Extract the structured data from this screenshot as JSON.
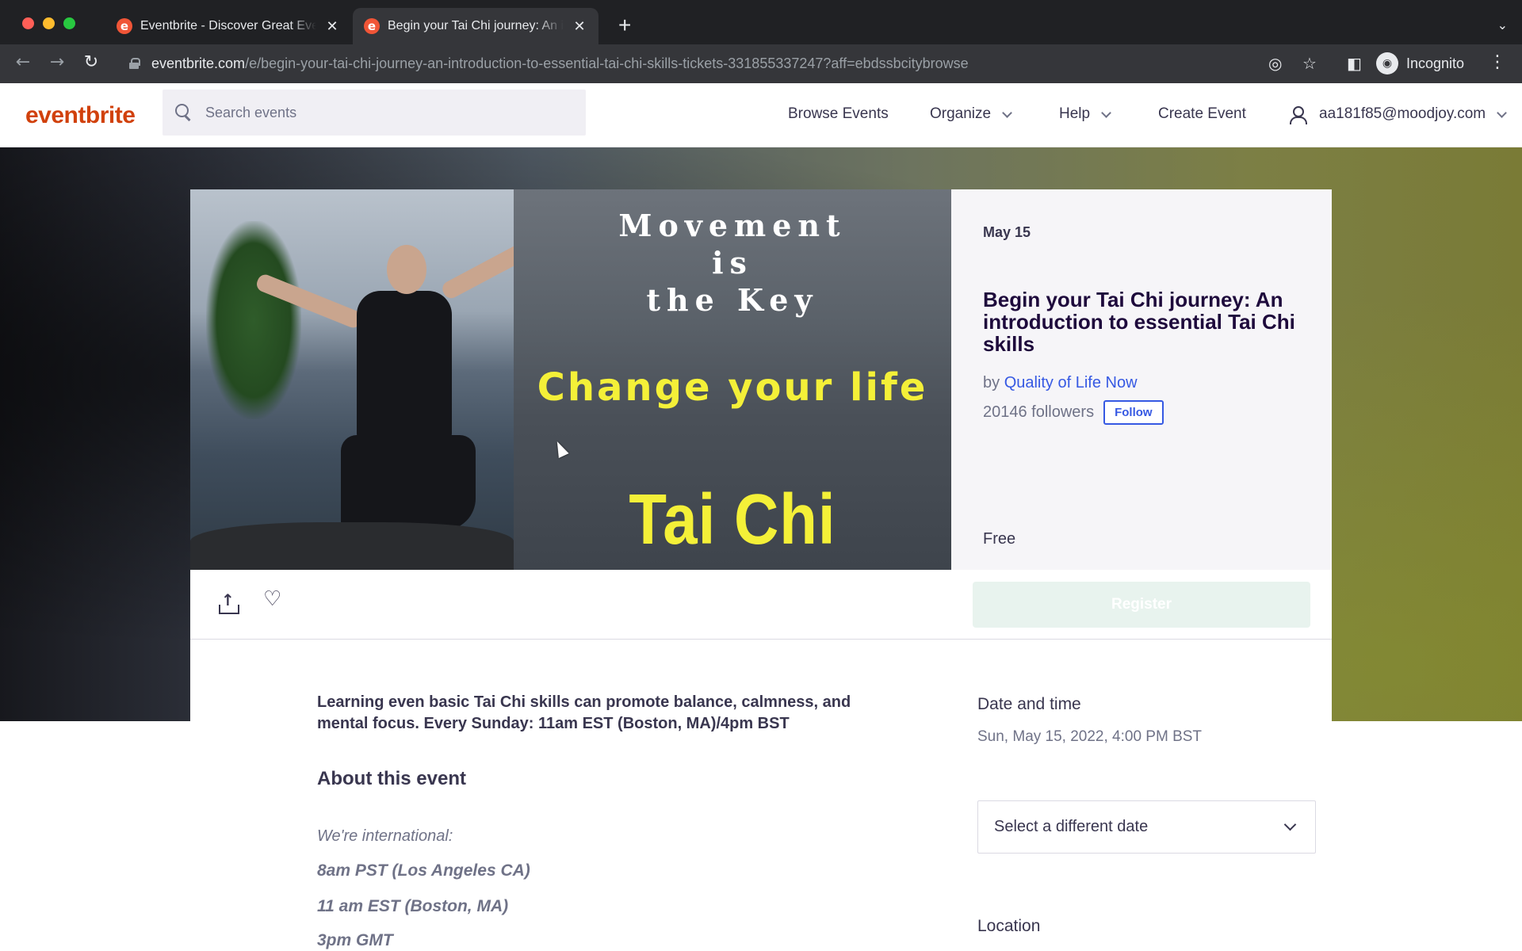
{
  "browser": {
    "tabs": [
      {
        "title": "Eventbrite - Discover Great Events or Create Your Own",
        "favicon": "e",
        "active": false
      },
      {
        "title": "Begin your Tai Chi journey: An introduction to essential Tai Chi skills Tickets",
        "favicon": "e",
        "active": true
      }
    ],
    "new_tab_symbol": "+",
    "overflow_symbol": "⌄",
    "url_domain": "eventbrite.com",
    "url_path": "/e/begin-your-tai-chi-journey-an-introduction-to-essential-tai-chi-skills-tickets-331855337247?aff=ebdssbcitybrowse",
    "profile_label": "Incognito",
    "icons": {
      "back": "arrow-left-icon",
      "forward": "arrow-right-icon",
      "reload": "reload-icon",
      "lock": "lock-icon",
      "eye_off": "eye-off-icon",
      "star": "star-icon",
      "side_panel": "side-panel-icon",
      "menu": "kebab-menu-icon"
    }
  },
  "header": {
    "logo": "eventbrite",
    "search_placeholder": "Search events",
    "nav": {
      "browse": "Browse Events",
      "organize": "Organize",
      "help": "Help",
      "create": "Create Event",
      "user_email": "aa181f85@moodjoy.com"
    },
    "brand_color": "#d1410c"
  },
  "event": {
    "image_text": {
      "line1": "Movement",
      "line2": "is",
      "line3": "the Key",
      "line4": "Change your life",
      "line5": "Tai Chi Sundays"
    },
    "date_short": "May 15",
    "title": "Begin your Tai Chi journey: An introduction to essential Tai Chi skills",
    "by_prefix": "by",
    "organizer": "Quality of Life Now",
    "followers": "20146 followers",
    "follow_label": "Follow",
    "price": "Free",
    "register_label": "Register",
    "summary": "Learning even basic Tai Chi skills can promote balance, calmness, and mental focus. Every Sunday: 11am EST (Boston, MA)/4pm BST",
    "about_heading": "About this event",
    "about_intro": "We're international:",
    "about_lines": [
      "8am PST (Los Angeles CA)",
      "11 am EST (Boston, MA)",
      "3pm GMT"
    ],
    "date_time_heading": "Date and time",
    "date_time_value": "Sun, May 15, 2022, 4:00 PM BST",
    "select_date_label": "Select a different date",
    "location_heading": "Location"
  },
  "colors": {
    "link_blue": "#3659e3",
    "text_dark": "#39364f",
    "register_disabled": "#e8f3ee",
    "image_yellow": "#f4f038"
  }
}
